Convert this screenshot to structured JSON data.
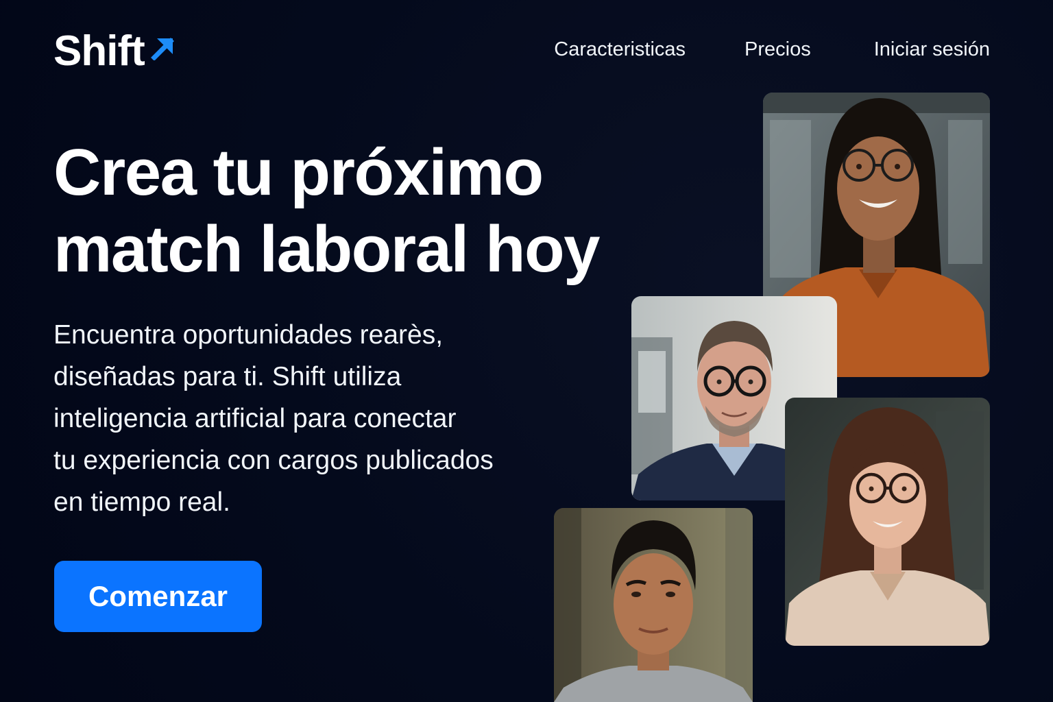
{
  "brand": {
    "name": "Shift",
    "icon": "arrow-up-right-icon",
    "accent_color": "#1d8cf8"
  },
  "nav": {
    "items": [
      {
        "label": "Caracteristicas"
      },
      {
        "label": "Precios"
      },
      {
        "label": "Iniciar sesión"
      }
    ]
  },
  "hero": {
    "headline_lines": [
      "Crea tu próximo",
      "match laboral hoy"
    ],
    "description_lines": [
      "Encuentra oportunidades rearès,",
      "diseñadas para ti. Shift utiliza",
      "inteligencia artificial para conectar",
      "tu experiencia con cargos publicados",
      "en tiempo real."
    ],
    "cta_label": "Comenzar",
    "cta_color": "#0b74ff"
  },
  "photos": [
    {
      "subject": "woman-orange-blouse-glasses"
    },
    {
      "subject": "man-glasses-sweater"
    },
    {
      "subject": "woman-glasses-beige-blouse"
    },
    {
      "subject": "young-man-grey-tshirt"
    }
  ],
  "colors": {
    "background": "#020617",
    "text": "#ffffff"
  }
}
